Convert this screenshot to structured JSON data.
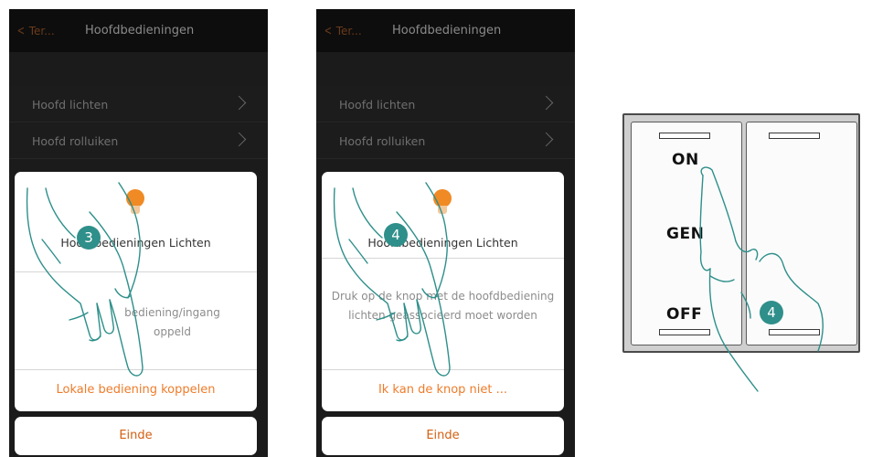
{
  "screens": [
    {
      "header": {
        "back_label": "Ter...",
        "title": "Hoofdbedieningen"
      },
      "list": [
        {
          "label": "Hoofd lichten"
        },
        {
          "label": "Hoofd rolluiken"
        }
      ],
      "dialog": {
        "title": "Hoofdbedieningen Lichten",
        "message_line1": "bediening/ingang",
        "message_line2": "oppeld",
        "action_label": "Lokale bediening koppelen"
      },
      "finish_label": "Einde",
      "step_number": "3"
    },
    {
      "header": {
        "back_label": "Ter...",
        "title": "Hoofdbedieningen"
      },
      "list": [
        {
          "label": "Hoofd lichten"
        },
        {
          "label": "Hoofd rolluiken"
        }
      ],
      "dialog": {
        "title": "Hoofdbedieningen Lichten",
        "message_line1": "Druk op de knop met de hoofdbediening",
        "message_line2": "lichten geassocieerd moet worden",
        "action_label": "Ik kan de knop niet ..."
      },
      "finish_label": "Einde",
      "step_number": "4"
    }
  ],
  "switch": {
    "labels": {
      "top": "ON",
      "middle": "GEN",
      "bottom": "OFF"
    },
    "step_number": "4"
  },
  "colors": {
    "accent": "#ee7c2b",
    "step_badge": "#2f8f8a",
    "bulb": "#f08a24",
    "screen_background": "#1b1b1b"
  }
}
